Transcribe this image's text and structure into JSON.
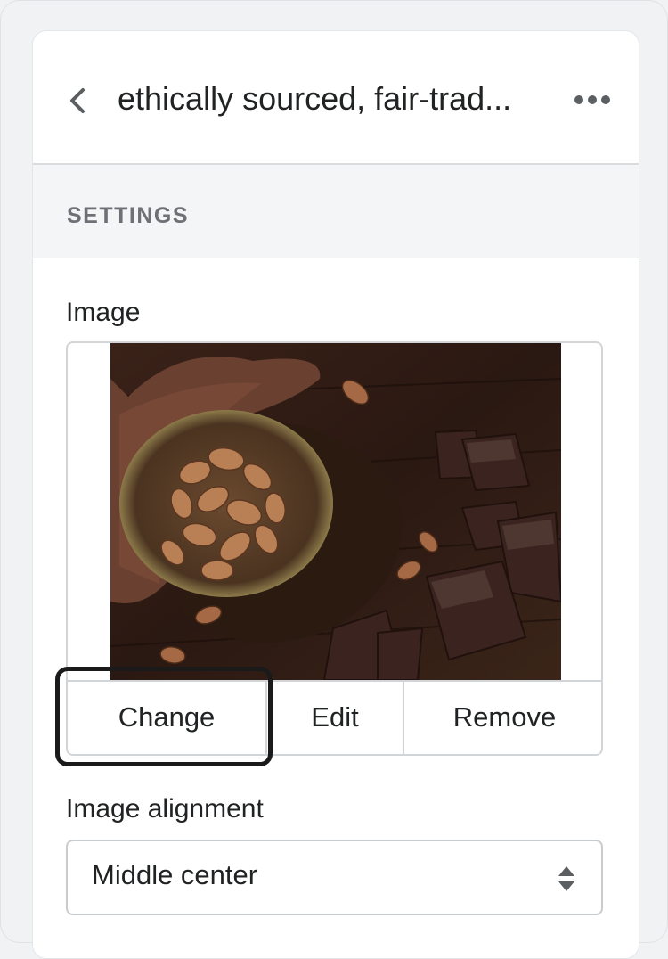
{
  "header": {
    "title": "ethically sourced, fair-trad...",
    "back_icon": "chevron-left-icon",
    "more_icon": "horizontal-dots-icon"
  },
  "settings": {
    "section_label": "SETTINGS"
  },
  "image_field": {
    "label": "Image",
    "change_label": "Change",
    "edit_label": "Edit",
    "remove_label": "Remove"
  },
  "alignment_field": {
    "label": "Image alignment",
    "selected_value": "Middle center",
    "arrows_icon": "select-arrows-icon"
  },
  "colors": {
    "text": "#202223",
    "subdued": "#6d7175",
    "border": "#d2d5d8",
    "focus": "#1a1a1a",
    "band": "#f4f5f7"
  }
}
